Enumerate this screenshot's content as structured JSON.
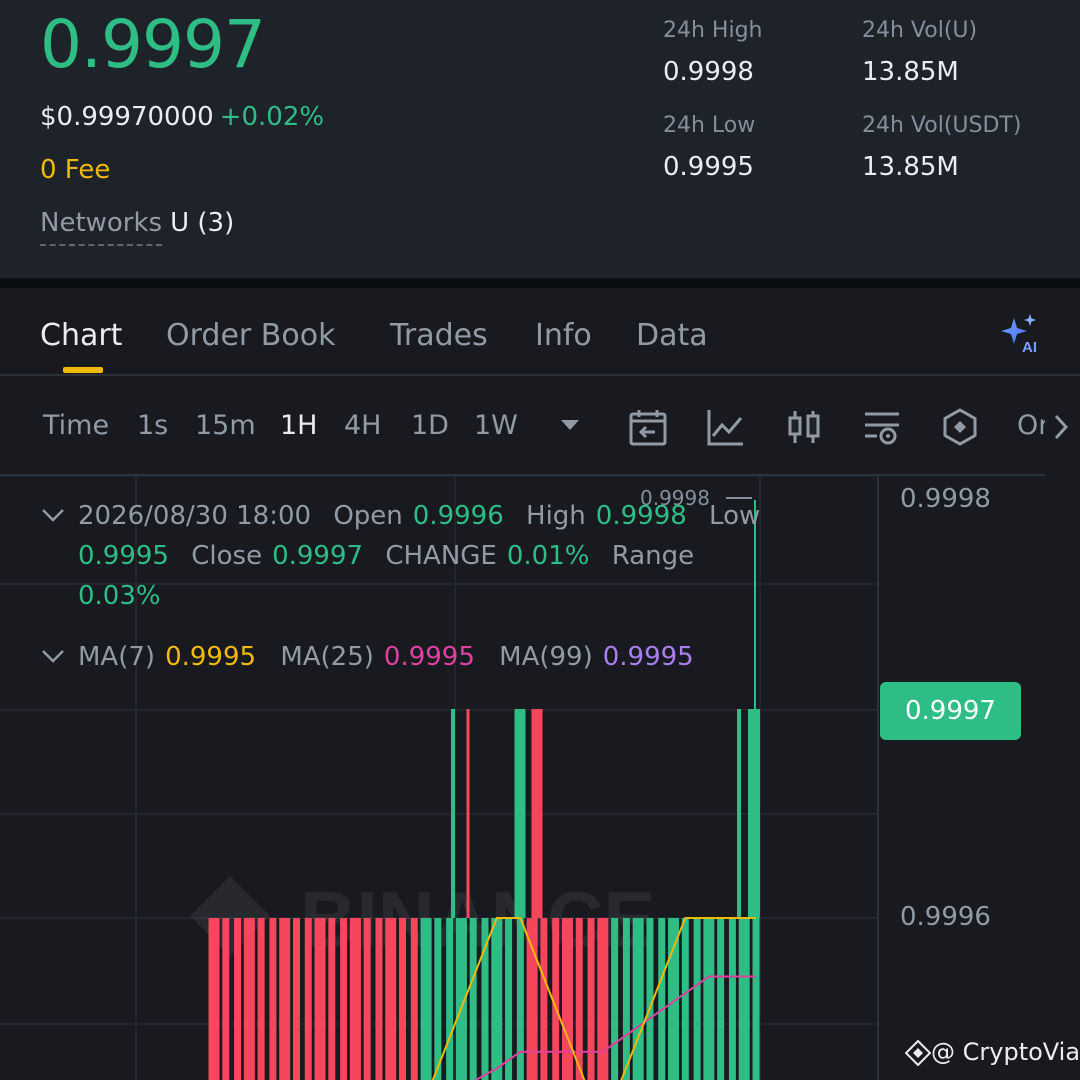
{
  "ticker": {
    "last_price": "0.9997",
    "usd_price": "$0.99970000",
    "change_pct": "+0.02%",
    "fee": "0 Fee",
    "networks_label": "Networks",
    "networks_value": "U (3)",
    "stats": [
      {
        "label": "24h High",
        "value": "0.9998"
      },
      {
        "label": "24h Vol(U)",
        "value": "13.85M"
      },
      {
        "label": "24h Low",
        "value": "0.9995"
      },
      {
        "label": "24h Vol(USDT)",
        "value": "13.85M"
      }
    ]
  },
  "tabs": [
    {
      "label": "Chart",
      "active": true
    },
    {
      "label": "Order Book",
      "active": false
    },
    {
      "label": "Trades",
      "active": false
    },
    {
      "label": "Info",
      "active": false
    },
    {
      "label": "Data",
      "active": false
    }
  ],
  "toolbar": {
    "time_label": "Time",
    "intervals": [
      {
        "label": "1s",
        "active": false
      },
      {
        "label": "15m",
        "active": false
      },
      {
        "label": "1H",
        "active": true
      },
      {
        "label": "4H",
        "active": false
      },
      {
        "label": "1D",
        "active": false
      },
      {
        "label": "1W",
        "active": false
      }
    ],
    "more_label": "Or",
    "icons": [
      "calendar-back-icon",
      "line-chart-icon",
      "candlestick-icon",
      "indicator-settings-icon",
      "hexagon-icon"
    ]
  },
  "ohlc": {
    "datetime": "2026/08/30 18:00",
    "open_label": "Open",
    "open": "0.9996",
    "high_label": "High",
    "high": "0.9998",
    "low_label": "Low",
    "low": "0.9995",
    "close_label": "Close",
    "close": "0.9997",
    "change_label": "CHANGE",
    "change": "0.01%",
    "range_label": "Range",
    "range": "0.03%"
  },
  "ma": {
    "ma7_label": "MA(7)",
    "ma7": "0.9995",
    "ma25_label": "MA(25)",
    "ma25": "0.9995",
    "ma99_label": "MA(99)",
    "ma99": "0.9995"
  },
  "colors": {
    "up": "#2ebd85",
    "down": "#f6465d",
    "ma7": "#f0b90b",
    "ma25": "#e040a0",
    "ma99": "#a97ff0",
    "accent": "#f0b90b"
  },
  "chart_data": {
    "type": "candlestick",
    "y_axis_labels": [
      "0.9998",
      "0.9996"
    ],
    "current_price": "0.9997",
    "high_marker": "0.9998",
    "ylim": [
      0.99945,
      0.99982
    ],
    "candles": [
      {
        "o": 0.9996,
        "c": 0.9995
      },
      {
        "o": 0.9996,
        "c": 0.9995
      },
      {
        "o": 0.9996,
        "c": 0.9995
      },
      {
        "o": 0.9996,
        "c": 0.9995
      },
      {
        "o": 0.9996,
        "c": 0.9995
      },
      {
        "o": 0.9996,
        "c": 0.9995
      },
      {
        "o": 0.9996,
        "c": 0.9995
      },
      {
        "o": 0.9996,
        "c": 0.9995
      },
      {
        "o": 0.9996,
        "c": 0.9995
      },
      {
        "o": 0.9996,
        "c": 0.9995
      },
      {
        "o": 0.9996,
        "c": 0.9995
      },
      {
        "o": 0.9996,
        "c": 0.9995
      },
      {
        "o": 0.9996,
        "c": 0.9995
      },
      {
        "o": 0.9996,
        "c": 0.9995
      },
      {
        "o": 0.9996,
        "c": 0.9995
      },
      {
        "o": 0.9996,
        "c": 0.9995
      },
      {
        "o": 0.9996,
        "c": 0.9995
      },
      {
        "o": 0.9996,
        "c": 0.9995
      },
      {
        "o": 0.9995,
        "c": 0.9996
      },
      {
        "o": 0.9995,
        "c": 0.9996
      },
      {
        "o": 0.9995,
        "c": 0.9996
      },
      {
        "o": 0.9995,
        "c": 0.9996
      },
      {
        "o": 0.9995,
        "c": 0.9996
      },
      {
        "o": 0.9995,
        "c": 0.9996
      },
      {
        "o": 0.9995,
        "c": 0.9996
      },
      {
        "o": 0.9995,
        "c": 0.9996
      },
      {
        "o": 0.9995,
        "c": 0.9996
      },
      {
        "o": 0.9996,
        "c": 0.9995
      },
      {
        "o": 0.9996,
        "c": 0.9995
      },
      {
        "o": 0.9996,
        "c": 0.9995
      },
      {
        "o": 0.9996,
        "c": 0.9995
      },
      {
        "o": 0.9996,
        "c": 0.9995
      },
      {
        "o": 0.9996,
        "c": 0.9995
      },
      {
        "o": 0.9996,
        "c": 0.9995
      },
      {
        "o": 0.9995,
        "c": 0.9996
      },
      {
        "o": 0.9995,
        "c": 0.9996
      },
      {
        "o": 0.9995,
        "c": 0.9996
      },
      {
        "o": 0.9995,
        "c": 0.9996
      },
      {
        "o": 0.9995,
        "c": 0.9996
      },
      {
        "o": 0.9995,
        "c": 0.9996
      },
      {
        "o": 0.9995,
        "c": 0.9996
      },
      {
        "o": 0.9995,
        "c": 0.9996
      },
      {
        "o": 0.9995,
        "c": 0.9996
      },
      {
        "o": 0.9995,
        "c": 0.9996
      },
      {
        "o": 0.9995,
        "c": 0.9996
      },
      {
        "o": 0.9995,
        "c": 0.9996
      },
      {
        "o": 0.9995,
        "c": 0.9996
      }
    ]
  },
  "watermark": "@ CryptoVia"
}
